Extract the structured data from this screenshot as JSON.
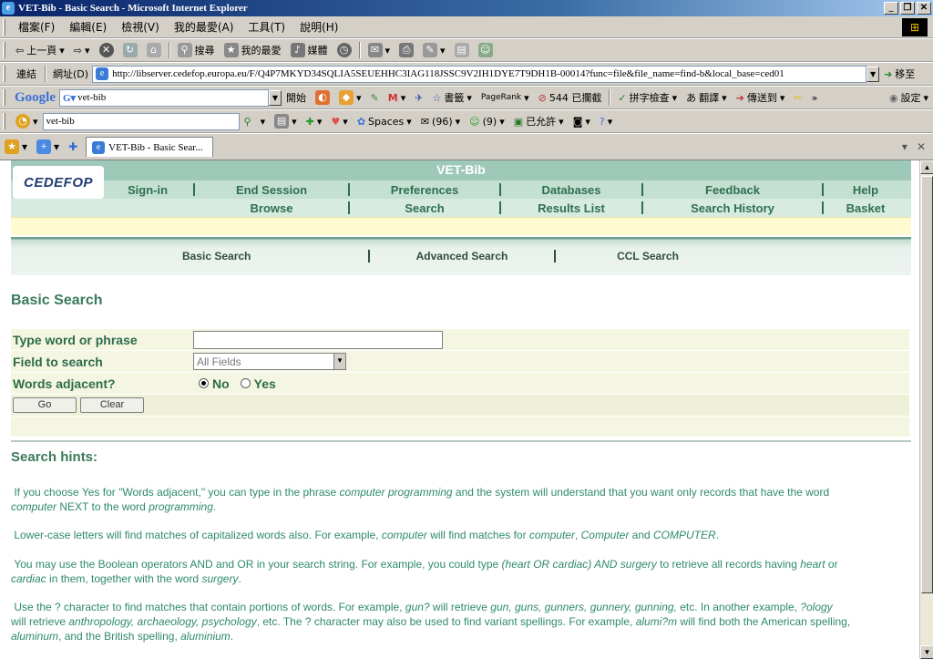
{
  "window": {
    "title": "VET-Bib - Basic Search - Microsoft Internet Explorer"
  },
  "menubar": {
    "items": [
      "檔案(F)",
      "編輯(E)",
      "檢視(V)",
      "我的最愛(A)",
      "工具(T)",
      "說明(H)"
    ]
  },
  "toolbar": {
    "back": "上一頁",
    "search": "搜尋",
    "favorites": "我的最愛",
    "media": "媒體"
  },
  "address": {
    "links_label": "連結",
    "label": "網址(D)",
    "url": "http://libserver.cedefop.europa.eu/F/Q4P7MKYD34SQLIA5SEUEHHC3IAG118JSSC9V2IH1DYE7T9DH1B-00014?func=file&file_name=find-b&local_base=ced01",
    "go": "移至"
  },
  "google_bar": {
    "logo": "Google",
    "query": "vet-bib",
    "search_btn": "開始",
    "bookmarks": "書籤",
    "pagerank": "PageRank",
    "blocked": "544 已攔截",
    "spellcheck": "拼字檢查",
    "translate": "翻譯",
    "send_to": "傳送到",
    "more": "»",
    "settings": "設定"
  },
  "live_bar": {
    "query": "vet-bib",
    "spaces": "Spaces",
    "mail_count": "(96)",
    "msn_count": "(9)",
    "allowed": "已允許"
  },
  "tab": {
    "title": "VET-Bib - Basic Sear..."
  },
  "site": {
    "logo": "CEDEFOP",
    "app_title": "VET-Bib",
    "nav_row1": [
      "Sign-in",
      "End Session",
      "Preferences",
      "Databases",
      "Feedback",
      "Help"
    ],
    "nav_row2": [
      "Browse",
      "Search",
      "Results List",
      "Search History",
      "Basket"
    ],
    "search_tabs": [
      "Basic Search",
      "Advanced Search",
      "CCL Search"
    ]
  },
  "form": {
    "heading": "Basic Search",
    "word_label": "Type word or phrase",
    "word_value": "",
    "field_label": "Field to search",
    "field_selected": "All Fields",
    "adjacent_label": "Words adjacent?",
    "adjacent_no": "No",
    "adjacent_yes": "Yes",
    "go": "Go",
    "clear": "Clear"
  },
  "hints": {
    "title": "Search hints:",
    "h1": [
      "If you choose Yes for \"Words adjacent,\" you can type in the phrase ",
      "computer programming",
      " and the system will understand that you want only records that have the word ",
      "computer",
      " NEXT to the word ",
      "programming",
      "."
    ],
    "h2": [
      "Lower-case letters will find matches of capitalized words also. For example, ",
      "computer",
      " will find matches for ",
      "computer",
      ", ",
      "Computer",
      " and ",
      "COMPUTER",
      "."
    ],
    "h3": [
      "You may use the Boolean operators AND and OR in your search string. For example, you could type ",
      "(heart OR cardiac) AND surgery",
      " to retrieve all records having ",
      "heart",
      " or ",
      "cardiac",
      " in them, together with the word ",
      "surgery",
      "."
    ],
    "h4": [
      "Use the ? character to find matches that contain portions of words. For example, ",
      "gun?",
      " will retrieve ",
      "gun, guns, gunners, gunnery, gunning,",
      " etc. In another example, ",
      "?ology",
      " will retrieve ",
      "anthropology, archaeology, psychology",
      ", etc. The ? character may also be used to find variant spellings. For example, ",
      "alumi?m",
      " will find both the American spelling, ",
      "aluminum",
      ", and the British spelling, ",
      "aluminium",
      "."
    ]
  },
  "colors": {
    "header_green": "#9ec9b8",
    "nav_text": "#2f6f4f",
    "hint_text": "#2e8a6a",
    "label_text": "#2e6b4a"
  }
}
